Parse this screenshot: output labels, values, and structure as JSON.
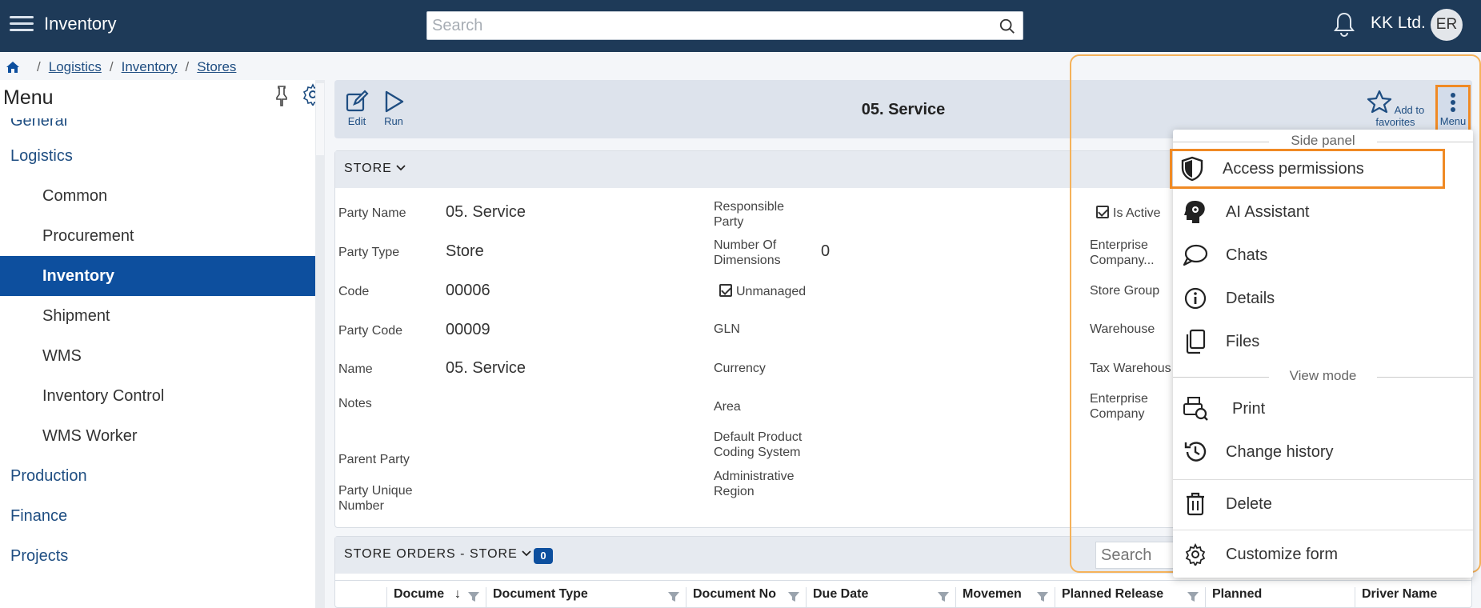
{
  "app": {
    "title": "Inventory",
    "search_placeholder": "Search",
    "company": "KK Ltd.",
    "user_initials": "ER"
  },
  "breadcrumb": [
    "Logistics",
    "Inventory",
    "Stores"
  ],
  "menu": {
    "title": "Menu",
    "items": [
      {
        "label": "General",
        "level": "top"
      },
      {
        "label": "Logistics",
        "level": "top"
      },
      {
        "label": "Common",
        "level": "sub"
      },
      {
        "label": "Procurement",
        "level": "sub"
      },
      {
        "label": "Inventory",
        "level": "sub",
        "active": true
      },
      {
        "label": "Shipment",
        "level": "sub"
      },
      {
        "label": "WMS",
        "level": "sub"
      },
      {
        "label": "Inventory Control",
        "level": "sub"
      },
      {
        "label": "WMS Worker",
        "level": "sub"
      },
      {
        "label": "Production",
        "level": "top"
      },
      {
        "label": "Finance",
        "level": "top"
      },
      {
        "label": "Projects",
        "level": "top"
      }
    ]
  },
  "toolbar": {
    "edit_label": "Edit",
    "run_label": "Run",
    "favorites_label": "Add to favorites",
    "menu_label": "Menu"
  },
  "record": {
    "title": "05. Service"
  },
  "store_section": {
    "label": "STORE",
    "col1": [
      {
        "label": "Party Name",
        "value": "05. Service"
      },
      {
        "label": "Party Type",
        "value": "Store"
      },
      {
        "label": "Code",
        "value": "00006"
      },
      {
        "label": "Party Code",
        "value": "00009"
      },
      {
        "label": "Name",
        "value": "05. Service"
      },
      {
        "label": "Notes",
        "value": ""
      },
      {
        "label": "Parent Party",
        "value": ""
      },
      {
        "label": "Party Unique Number",
        "value": ""
      }
    ],
    "col2": {
      "responsible_party": "Responsible Party",
      "num_dimensions_label": "Number Of Dimensions",
      "num_dimensions_value": "0",
      "unmanaged": "Unmanaged",
      "gln": "GLN",
      "currency": "Currency",
      "area": "Area",
      "default_coding": "Default Product Coding System",
      "admin_region": "Administrative Region"
    },
    "col3": {
      "is_active": "Is Active",
      "enterprise_company_short": "Enterprise Company...",
      "store_group": "Store Group",
      "warehouse": "Warehouse",
      "tax_warehouse": "Tax Warehous",
      "enterprise_company": "Enterprise Company"
    }
  },
  "orders_section": {
    "label": "STORE ORDERS - STORE",
    "count": "0",
    "search_placeholder": "Search",
    "columns": [
      "Docume",
      "Document Type",
      "Document No",
      "Due Date",
      "Movemen",
      "Planned Release",
      "Planned",
      "Driver Name"
    ]
  },
  "dropdown": {
    "group_side_panel": "Side panel",
    "group_view_mode": "View mode",
    "items": {
      "access_permissions": "Access permissions",
      "ai_assistant": "AI Assistant",
      "chats": "Chats",
      "details": "Details",
      "files": "Files",
      "print": "Print",
      "change_history": "Change history",
      "delete": "Delete",
      "customize_form": "Customize form"
    },
    "colors": {
      "highlight": "#f08a24",
      "accent": "#0d4f9e"
    }
  }
}
